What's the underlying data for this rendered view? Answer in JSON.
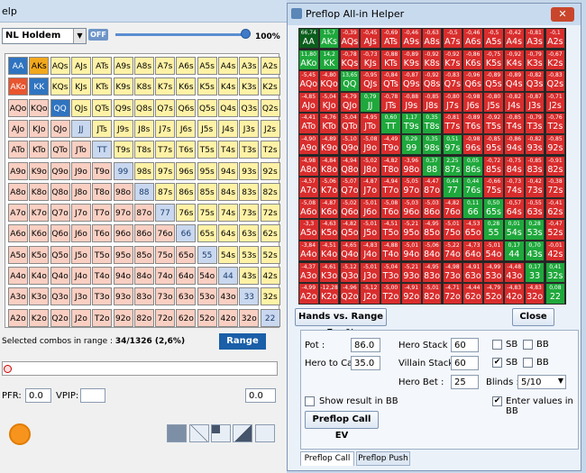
{
  "bg": {
    "title": "elp",
    "game": "NL Holdem",
    "off": "OFF",
    "pct": "100%",
    "combos_label": "Selected combos in range :",
    "combos_value": "34/1326 (2,6%)",
    "range_btn": "Range",
    "pfr_label": "PFR:",
    "pfr": "0.0",
    "vpip_label": "VPIP:",
    "vpip": "",
    "right_val": "0.0"
  },
  "ranks": [
    "A",
    "K",
    "Q",
    "J",
    "T",
    "9",
    "8",
    "7",
    "6",
    "5",
    "4",
    "3",
    "2"
  ],
  "dialog": {
    "title": "Preflop All-in Helper",
    "close_x": "✕",
    "hvr": "Hands vs. Range Eq. %",
    "close": "Close",
    "pot_label": "Pot :",
    "pot": "86.0",
    "htc_label": "Hero to Call :",
    "htc": "35.0",
    "hs_label": "Hero Stack :",
    "hs": "60",
    "vs_label": "Villain Stack :",
    "vs": "60",
    "hb_label": "Hero Bet :",
    "hb": "25",
    "sb": "SB",
    "bb": "BB",
    "blinds_label": "Blinds :",
    "blinds": "5/10",
    "show_bb": "Show result in BB",
    "enter_bb": "Enter values in BB",
    "calc": "Preflop Call EV",
    "tab1": "Preflop Call",
    "tab2": "Preflop Push"
  },
  "colors": {
    "pair": "#2f74c0",
    "suited": "#fff2a6",
    "offsuit": "#f9cfc2",
    "sel": "#f2a81d",
    "green": "#1fa83c",
    "red": "#d92d2d",
    "darkgreen": "#0b5e1c"
  },
  "ev": [
    [
      "66,74",
      "15,7",
      "-0,39",
      "-0,45",
      "-0,69",
      "-0,46",
      "-0,63",
      "-0,5",
      "-0,46",
      "-0,5",
      "-0,42",
      "-0,81",
      "-0,1"
    ],
    [
      "11,80",
      "14,2",
      "-0,78",
      "-0,73",
      "-0,88",
      "-0,89",
      "-0,92",
      "-0,92",
      "-0,86",
      "-0,75",
      "-0,92",
      "-0,79",
      "-0,67"
    ],
    [
      "-5,45",
      "-4,80",
      "13,65",
      "-0,95",
      "-0,84",
      "-0,87",
      "-0,92",
      "-0,83",
      "-0,96",
      "-0,89",
      "-0,89",
      "-0,82",
      "-0,83"
    ],
    [
      "-4,85",
      "-5,04",
      "-4,79",
      "0,79",
      "-0,78",
      "-0,88",
      "-0,85",
      "-0,80",
      "-0,98",
      "-0,80",
      "-0,82",
      "-0,87",
      "-0,71"
    ],
    [
      "-4,41",
      "-4,76",
      "-5,04",
      "-4,95",
      "0,60",
      "1,17",
      "0,35",
      "-0,81",
      "-0,89",
      "-0,92",
      "-0,85",
      "-0,79",
      "-0,76"
    ],
    [
      "-4,90",
      "-4,89",
      "-5,10",
      "-5,08",
      "-4,49",
      "0,29",
      "0,35",
      "0,51",
      "-0,98",
      "-0,85",
      "-0,86",
      "-0,82",
      "-0,85"
    ],
    [
      "-4,98",
      "-4,84",
      "-4,94",
      "-5,02",
      "-4,82",
      "-3,96",
      "0,37",
      "2,25",
      "0,05",
      "-0,72",
      "-0,75",
      "-0,85",
      "-0,91"
    ],
    [
      "-4,57",
      "-5,06",
      "-5,07",
      "-4,87",
      "-4,94",
      "-5,05",
      "-4,47",
      "0,44",
      "0,44",
      "-0,66",
      "-0,73",
      "-0,42",
      "-0,38"
    ],
    [
      "-5,08",
      "-4,87",
      "-5,02",
      "-5,01",
      "-5,08",
      "-5,03",
      "-5,03",
      "-4,82",
      "0,11",
      "0,50",
      "-0,57",
      "-0,55",
      "-0,41"
    ],
    [
      "-3,3",
      "-4,63",
      "-4,82",
      "-5,01",
      "-4,51",
      "-5,21",
      "-4,95",
      "-5,01",
      "-4,53",
      "0,28",
      "0,01",
      "0,28",
      "-0,47"
    ],
    [
      "-3,84",
      "-4,51",
      "-4,65",
      "-4,83",
      "-4,88",
      "-5,01",
      "-5,06",
      "-5,22",
      "-4,73",
      "-5,01",
      "0,17",
      "0,70",
      "-0,01"
    ],
    [
      "-4,37",
      "-4,61",
      "-5,12",
      "-5,01",
      "-5,04",
      "-5,21",
      "-4,95",
      "-4,98",
      "-4,91",
      "-4,99",
      "-4,48",
      "0,17",
      "0,41"
    ],
    [
      "-4,99",
      "-12,28",
      "-4,96",
      "-5,12",
      "-5,00",
      "-4,91",
      "-5,01",
      "-4,71",
      "-4,44",
      "-4,79",
      "-4,83",
      "-4,83",
      "0,08"
    ]
  ]
}
